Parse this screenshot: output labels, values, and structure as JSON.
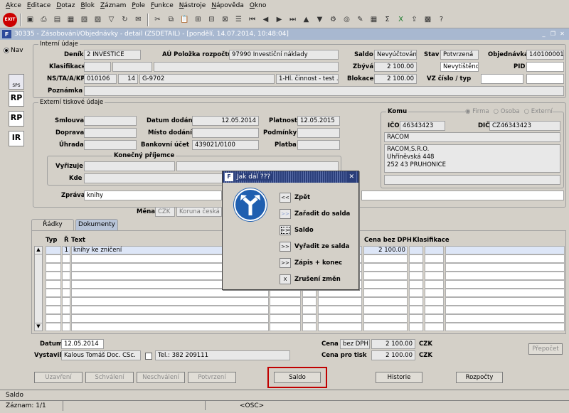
{
  "menu": [
    "Akce",
    "Editace",
    "Dotaz",
    "Blok",
    "Záznam",
    "Pole",
    "Funkce",
    "Nástroje",
    "Nápověda",
    "Okno"
  ],
  "window": {
    "title": "30335 - Zásobování/Objednávky - detail (ZSDETAIL) - [pondělí, 14.07.2014, 10:48:04]"
  },
  "nav": {
    "label": "Nav"
  },
  "side_icons": [
    {
      "label": "SPS"
    },
    {
      "label": "RP"
    },
    {
      "label": "RP"
    },
    {
      "label": "IR"
    }
  ],
  "internal": {
    "title": "Interní údaje",
    "denik_label": "Deník",
    "denik_value": "2 INVESTICE",
    "au_label": "AÚ Položka rozpočtu",
    "au_value": "97990 Investiční náklady",
    "klasifikace_label": "Klasifikace",
    "nstaakp_label": "NS/TA/A/KP",
    "ns_value": "010106",
    "ta_value": "14",
    "a_value": "G-9702",
    "kp_value": "1-Hl. činnost - test . bb",
    "poznamka_label": "Poznámka",
    "saldo_label": "Saldo",
    "saldo_value": "Nevyúčtováno",
    "zbyva_label": "Zbývá",
    "zbyva_value": "2 100.00",
    "blokace_label": "Blokace",
    "blokace_value": "2 100.00",
    "stav_label": "Stav",
    "stav_value": "Potvrzená",
    "stav2_value": "Nevytištěno",
    "objednavka_label": "Objednávka",
    "objednavka_value": "1401000017",
    "pid_label": "PID",
    "vz_label": "VZ číslo / typ"
  },
  "external": {
    "title": "Externí tiskové údaje",
    "smlouva_label": "Smlouva",
    "doprava_label": "Doprava",
    "uhrada_label": "Úhrada",
    "datum_dodani_label": "Datum dodání",
    "datum_dodani_value": "12.05.2014",
    "misto_dodani_label": "Místo dodání",
    "bankovni_ucet_label": "Bankovní účet",
    "bankovni_ucet_value": "439021/0100",
    "platnost_label": "Platnost",
    "platnost_value": "12.05.2015",
    "podminky_label": "Podmínky",
    "platba_label": "Platba",
    "konecny_title": "Konečný příjemce",
    "vyrizuje_label": "Vyřizuje",
    "kde_label": "Kde",
    "zprava_label": "Zpráva",
    "zprava_value": "knihy",
    "mena_label": "Měna",
    "mena_code": "CZK",
    "mena_name": "Koruna česká"
  },
  "komu": {
    "title": "Komu",
    "radio_firma": "Firma",
    "radio_osoba": "Osoba",
    "radio_externi": "Externí",
    "ico_label": "IČO",
    "ico_value": "46343423",
    "dic_label": "DIČ",
    "dic_value": "CZ46343423",
    "name": "RACOM",
    "address": [
      "RACOM,S.R.O.",
      "Uhříněvská  448",
      "252 43  PRUHONICE"
    ]
  },
  "tabs": [
    {
      "label": "Řádky"
    },
    {
      "label": "Dokumenty"
    }
  ],
  "table": {
    "headers": {
      "typ": "Typ",
      "r": "Ř",
      "text": "Text",
      "cena": "Cena bez DPH",
      "klasifikace": "Klasifikace"
    },
    "rows": [
      {
        "r": "1",
        "text": "knihy ke zničení",
        "cena": "2 100.00"
      }
    ]
  },
  "footer": {
    "datum_label": "Datum",
    "datum_value": "12.05.2014",
    "vystavil_label": "Vystavil",
    "vystavil_value": "Kalous Tomáš Doc. CSc.",
    "tel_value": "Tel.: 382 209111",
    "cena_label": "Cena",
    "cena_type": "bez DPH",
    "cena_value": "2 100.00",
    "cena_curr": "CZK",
    "cena_tisk_label": "Cena pro tisk",
    "cena_tisk_value": "2 100.00",
    "cena_tisk_curr": "CZK",
    "prepocet": "Přepočet"
  },
  "buttons": {
    "uzavreni": "Uzavření",
    "schvaleni": "Schválení",
    "neschvaleni": "Neschválení",
    "potvrzeni": "Potvrzení",
    "saldo": "Saldo",
    "historie": "Historie",
    "rozpocty": "Rozpočty"
  },
  "dialog": {
    "title": "Jak dál ???",
    "options": [
      {
        "btn": "<<",
        "label": "Zpět"
      },
      {
        "btn": ">>",
        "label": "Zařadit do salda"
      },
      {
        "btn": ">>",
        "label": "Saldo"
      },
      {
        "btn": ">>",
        "label": "Vyřadit ze salda"
      },
      {
        "btn": ">>",
        "label": "Zápis + konec"
      },
      {
        "btn": "X",
        "label": "Zrušení změn"
      }
    ]
  },
  "status": {
    "message": "Saldo",
    "record": "Záznam: 1/1",
    "osc": "<OSC>"
  },
  "colors": {
    "highlight": "#c00000",
    "dialog_title": "#2a3e7a",
    "selected_row": "#dde6f7"
  }
}
